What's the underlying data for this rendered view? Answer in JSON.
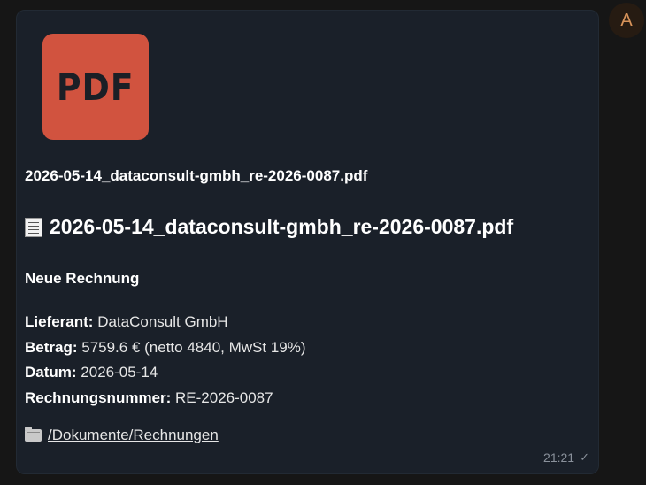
{
  "message": {
    "attachment": {
      "thumb_label": "PDF",
      "filename": "2026-05-14_dataconsult-gmbh_re-2026-0087.pdf"
    },
    "title": "2026-05-14_dataconsult-gmbh_re-2026-0087.pdf",
    "heading": "Neue Rechnung",
    "fields": [
      {
        "label": "Lieferant:",
        "value": " DataConsult GmbH"
      },
      {
        "label": "Betrag:",
        "value": " 5759.6 € (netto 4840, MwSt 19%)"
      },
      {
        "label": "Datum:",
        "value": " 2026-05-14"
      },
      {
        "label": "Rechnungsnummer:",
        "value": " RE-2026-0087"
      }
    ],
    "folder_link": "/Dokumente/Rechnungen",
    "time": "21:21",
    "status_icon": "check-icon"
  },
  "avatar": {
    "initial": "A",
    "color": "#d7935a"
  },
  "colors": {
    "pdf_badge": "#d1533f",
    "bubble": "#1a2029",
    "background": "#161616"
  }
}
